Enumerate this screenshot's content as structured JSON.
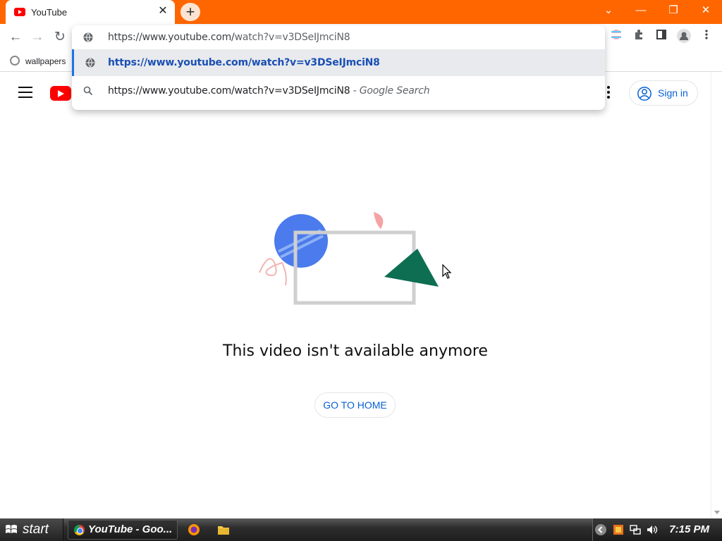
{
  "browser": {
    "tab": {
      "title": "YouTube",
      "close_glyph": "✕"
    },
    "new_tab_glyph": "+",
    "window_controls": {
      "dropdown": "⌄",
      "minimize": "—",
      "restore": "❐",
      "close": "✕"
    },
    "toolbar": {
      "back": "←",
      "forward": "→",
      "reload": "↻"
    },
    "bookmarks": [
      {
        "label": "wallpapers"
      }
    ],
    "omnibox": {
      "input_value_prefix": "https://www.youtube.com/",
      "input_value_rest": "watch?v=v3DSeIJmciN8",
      "suggestions": [
        {
          "text": "https://www.youtube.com/watch?v=v3DSeIJmciN8",
          "icon": "globe-icon",
          "selected": true
        },
        {
          "text": "https://www.youtube.com/watch?v=v3DSeIJmciN8",
          "suffix": " - Google Search",
          "icon": "search-icon",
          "selected": false
        }
      ]
    }
  },
  "youtube": {
    "sign_in_label": "Sign in",
    "message": "This video isn't available anymore",
    "home_button_label": "GO TO HOME"
  },
  "taskbar": {
    "start_label": "start",
    "task_item_label": "YouTube - Goo...",
    "clock": "7:15 PM"
  },
  "colors": {
    "titlebar": "#ff6600",
    "yt_red": "#ff0000",
    "link_blue": "#065fd4",
    "selected_suggestion": "#1a4fb4"
  }
}
